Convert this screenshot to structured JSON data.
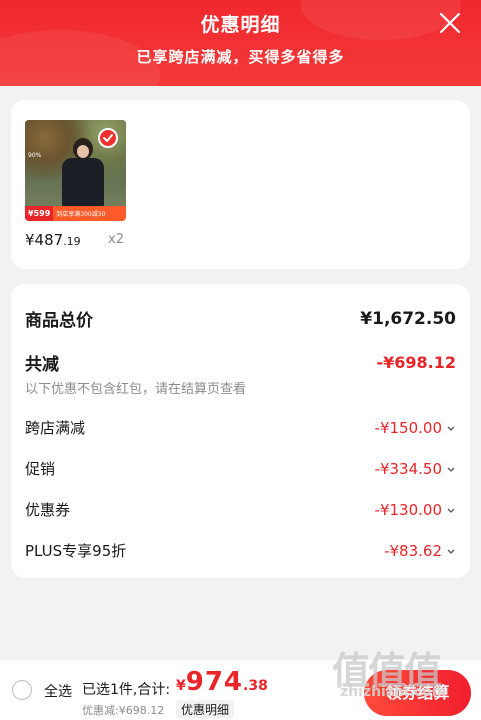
{
  "header": {
    "title": "优惠明细",
    "subtitle": "已享跨店满减，买得多省得多"
  },
  "product": {
    "thumb_overlay": "90%",
    "thumb_price": "¥599",
    "thumb_strip": "到店享满300减30",
    "price_int": "¥487",
    "price_dec": ".19",
    "qty": "x2"
  },
  "summary": {
    "total_label": "商品总价",
    "total_value": "¥1,672.50",
    "reduce_label": "共减",
    "reduce_value": "-¥698.12",
    "note": "以下优惠不包含红包，请在结算页查看",
    "items": [
      {
        "label": "跨店满减",
        "value": "-¥150.00"
      },
      {
        "label": "促销",
        "value": "-¥334.50"
      },
      {
        "label": "优惠券",
        "value": "-¥130.00"
      },
      {
        "label": "PLUS专享95折",
        "value": "-¥83.62"
      }
    ]
  },
  "bottom": {
    "select_all": "全选",
    "selected": "已选1件,合计:",
    "yen": "¥",
    "amount_int": "974",
    "amount_dec": ".38",
    "discount": "优惠减:¥698.12",
    "detail_link": "优惠明细",
    "checkout": "领券结算"
  },
  "watermark": {
    "big": "值值值",
    "small": "zhizhizhi.com"
  },
  "colors": {
    "accent_red": "#e8262a",
    "header_red": "#f0282d"
  }
}
